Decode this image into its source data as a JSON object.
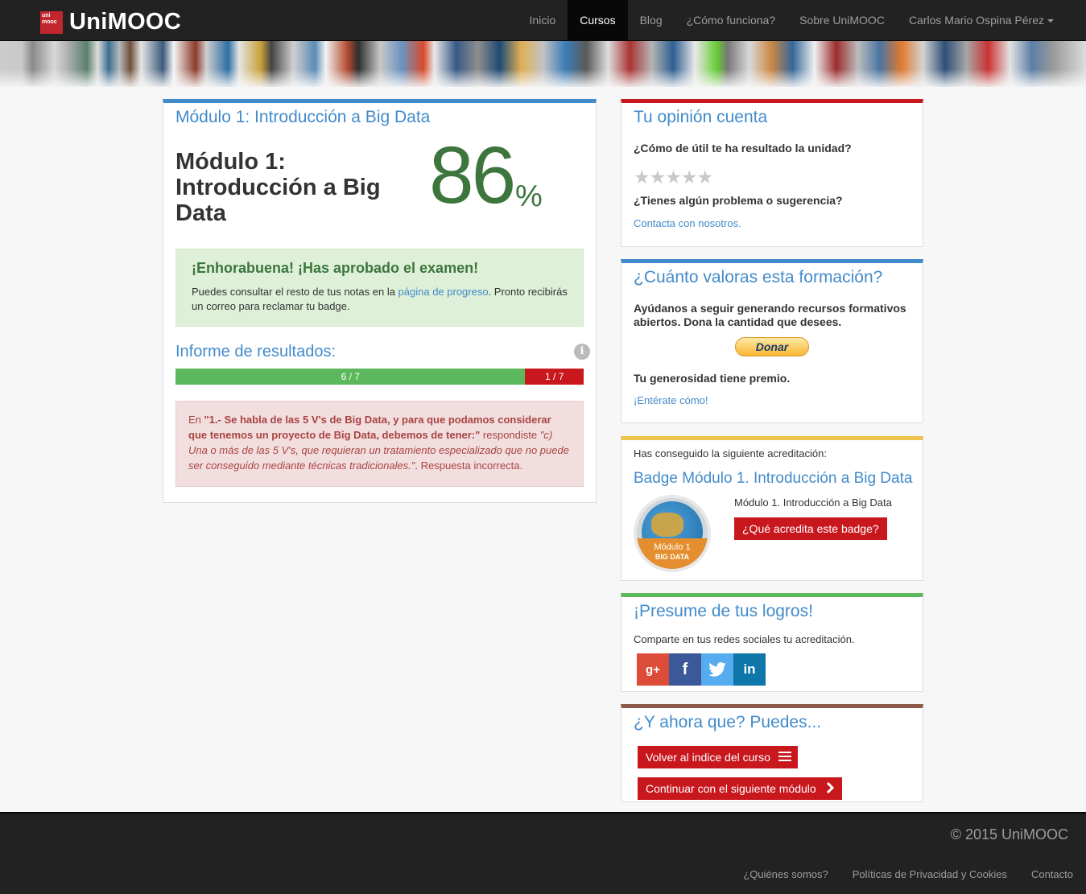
{
  "nav": {
    "brand_logo": "uni mooc",
    "brand": "UniMOOC",
    "items": [
      "Inicio",
      "Cursos",
      "Blog",
      "¿Cómo funciona?",
      "Sobre UniMOOC"
    ],
    "user": "Carlos Mario Ospina Pérez"
  },
  "main": {
    "panel_title": "Módulo 1: Introducción a Big Data",
    "big_title": "Módulo 1: Introducción a Big Data",
    "score": "86",
    "score_unit": "%",
    "success_title": "¡Enhorabuena! ¡Has aprobado el examen!",
    "success_text_1": "Puedes consultar el resto de tus notas en la ",
    "success_link": "página de progreso",
    "success_text_2": ". Pronto recibirás un correo para reclamar tu badge.",
    "results_title": "Informe de resultados:",
    "info_icon": "i",
    "correct_label": "6 / 7",
    "correct_fraction": 0.857,
    "incorrect_label": "1 / 7",
    "error_prefix": "En ",
    "error_question": "\"1.- Se habla de las 5 V's de Big Data, y para que podamos considerar que tenemos un proyecto de Big Data, debemos de tener:\"",
    "error_mid": " respondiste ",
    "error_answer": "\"c) Una o más de las 5 V's, que requieran un tratamiento especializado que no puede ser conseguido mediante técnicas tradicionales.\"",
    "error_suffix": ". Respuesta incorrecta."
  },
  "opinion": {
    "title": "Tu opinión cuenta",
    "q1": "¿Cómo de útil te ha resultado la unidad?",
    "stars": "★★★★★",
    "q2": "¿Tienes algún problema o sugerencia?",
    "link": "Contacta con nosotros."
  },
  "valoras": {
    "title": "¿Cuánto valoras esta formación?",
    "text": "Ayúdanos a seguir generando recursos formativos abiertos. Dona la cantidad que desees.",
    "donate": "Donar",
    "prize": "Tu generosidad tiene premio.",
    "link": "¡Entérate cómo!"
  },
  "badge": {
    "intro": "Has conseguido la siguiente acreditación:",
    "title": "Badge Módulo 1. Introducción a Big Data",
    "img_line1": "Módulo 1",
    "img_line2": "BIG DATA",
    "desc": "Módulo 1. Introducción a Big Data",
    "button": "¿Qué acredita este badge?"
  },
  "presume": {
    "title": "¡Presume de tus logros!",
    "text": "Comparte en tus redes sociales tu acreditación.",
    "icons": [
      "google-plus-icon",
      "facebook-icon",
      "twitter-icon",
      "linkedin-icon"
    ],
    "gp": "g+",
    "fb": "f",
    "tw": "🐦",
    "li": "in"
  },
  "ahora": {
    "title": "¿Y ahora que? Puedes...",
    "btn1": "Volver al indice del curso",
    "btn2": "Continuar con el siguiente módulo"
  },
  "footer": {
    "copyright": "© 2015 UniMOOC",
    "links": [
      "¿Quiénes somos?",
      "Políticas de Privacidad y Cookies",
      "Contacto"
    ]
  },
  "colors": {
    "brand_red": "#c9171e",
    "link_blue": "#428bca",
    "success_green": "#5cb85c",
    "score_green": "#3c763d"
  }
}
